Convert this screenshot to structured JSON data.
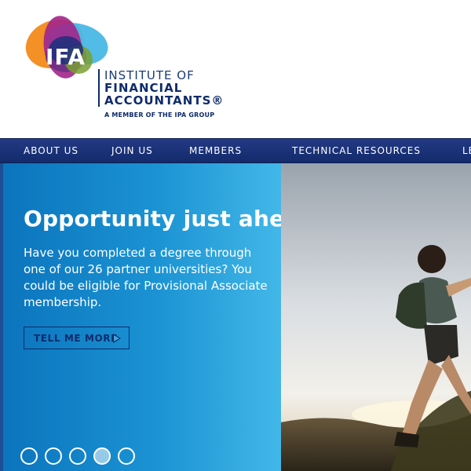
{
  "brand": {
    "logo_letters": "IFA",
    "line1": "INSTITUTE OF",
    "line2": "FINANCIAL",
    "line3": "ACCOUNTANTS®",
    "tagline": "A MEMBER OF THE IPA GROUP"
  },
  "nav": {
    "items": [
      {
        "label": "ABOUT US"
      },
      {
        "label": "JOIN US"
      },
      {
        "label": "MEMBERS"
      },
      {
        "label": "TECHNICAL RESOURCES"
      },
      {
        "label": "LE"
      }
    ]
  },
  "hero": {
    "title": "Opportunity just ahead",
    "text": "Have you completed a degree through one of our 26 partner universities? You could be eligible for Provisional Associate membership.",
    "cta_label": "TELL ME MORE",
    "cta_icon": "play-arrow-icon",
    "slides": {
      "count": 5,
      "active_index": 3
    }
  },
  "colors": {
    "nav_background": "#1b3378",
    "panel_gradient_start": "#0b74bd",
    "panel_gradient_end": "#42b7e8",
    "brand_navy": "#0f2b6b"
  }
}
